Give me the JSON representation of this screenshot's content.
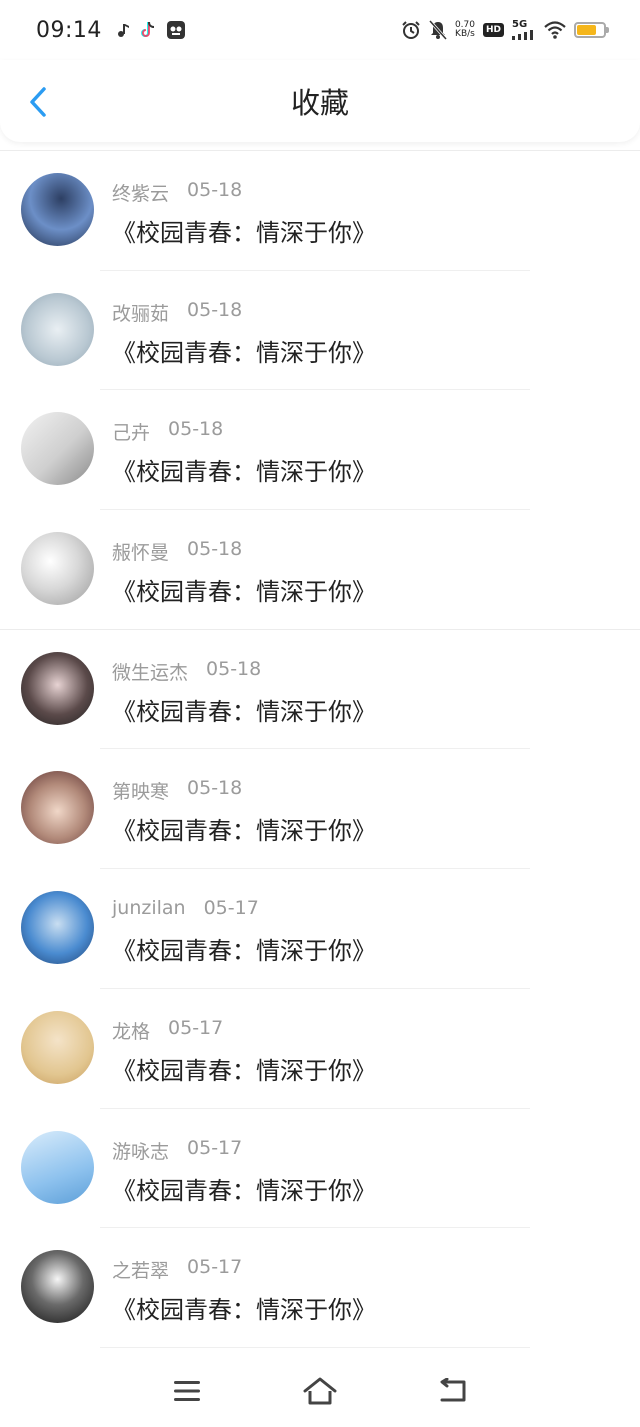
{
  "status_bar": {
    "time": "09:14",
    "net_speed_value": "0.70",
    "net_speed_unit": "KB/s",
    "hd": "HD",
    "signal_label": "5G",
    "battery_color": "#f5b61b",
    "icons": [
      "music-note-icon",
      "tiktok-icon",
      "app-icon",
      "alarm-icon",
      "bell-off-icon",
      "signal-icon",
      "wifi-icon",
      "battery-icon"
    ]
  },
  "header": {
    "title": "收藏",
    "back_icon": "chevron-left-icon",
    "accent": "#2b9cf2"
  },
  "favorites": [
    {
      "name": "终紫云",
      "date": "05-18",
      "title": "《校园青春：情深于你》"
    },
    {
      "name": "改骊茹",
      "date": "05-18",
      "title": "《校园青春：情深于你》"
    },
    {
      "name": "己卉",
      "date": "05-18",
      "title": "《校园青春：情深于你》"
    },
    {
      "name": "赧怀曼",
      "date": "05-18",
      "title": "《校园青春：情深于你》"
    },
    {
      "name": "微生运杰",
      "date": "05-18",
      "title": "《校园青春：情深于你》"
    },
    {
      "name": "第映寒",
      "date": "05-18",
      "title": "《校园青春：情深于你》"
    },
    {
      "name": "junzilan",
      "date": "05-17",
      "title": "《校园青春：情深于你》"
    },
    {
      "name": "龙格",
      "date": "05-17",
      "title": "《校园青春：情深于你》"
    },
    {
      "name": "游咏志",
      "date": "05-17",
      "title": "《校园青春：情深于你》"
    },
    {
      "name": "之若翠",
      "date": "05-17",
      "title": "《校园青春：情深于你》"
    }
  ],
  "nav_bar": {
    "icons": [
      "menu-icon",
      "home-icon",
      "back-icon"
    ]
  }
}
